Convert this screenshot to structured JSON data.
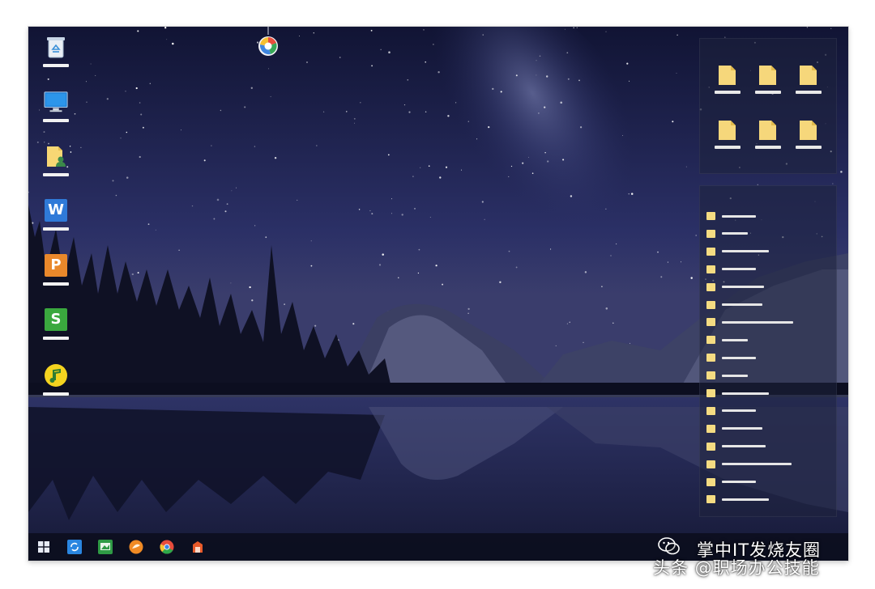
{
  "desktop": {
    "left_icons": [
      {
        "name": "recycle-bin-icon"
      },
      {
        "name": "computer-icon"
      },
      {
        "name": "user-folder-icon"
      },
      {
        "name": "wps-writer-icon",
        "letter": "W",
        "color": "#2f7ad8"
      },
      {
        "name": "wps-presentation-icon",
        "letter": "P",
        "color": "#e9882b"
      },
      {
        "name": "wps-spreadsheet-icon",
        "letter": "S",
        "color": "#3aa83e"
      },
      {
        "name": "music-player-icon",
        "color": "#f4d31f"
      }
    ],
    "top_badge": {
      "name": "skin-badge-icon"
    }
  },
  "fences": {
    "folders": {
      "count": 6,
      "folder_color": "#f6d77b"
    },
    "list": {
      "count": 17,
      "item_color": "#f5dc82"
    }
  },
  "taskbar": {
    "items": [
      {
        "name": "start-button-icon"
      },
      {
        "name": "sync-app-icon"
      },
      {
        "name": "photo-app-icon"
      },
      {
        "name": "media-player-icon"
      },
      {
        "name": "chrome-browser-icon"
      },
      {
        "name": "office-app-icon"
      }
    ]
  },
  "watermark": {
    "line1": "掌中IT发烧友圈",
    "line2": "头条 @职场办公技能"
  },
  "colors": {
    "sky_top": "#14163a",
    "sky_mid": "#2a2f63",
    "water": "#20244c",
    "taskbar": "#0c0e1e"
  }
}
